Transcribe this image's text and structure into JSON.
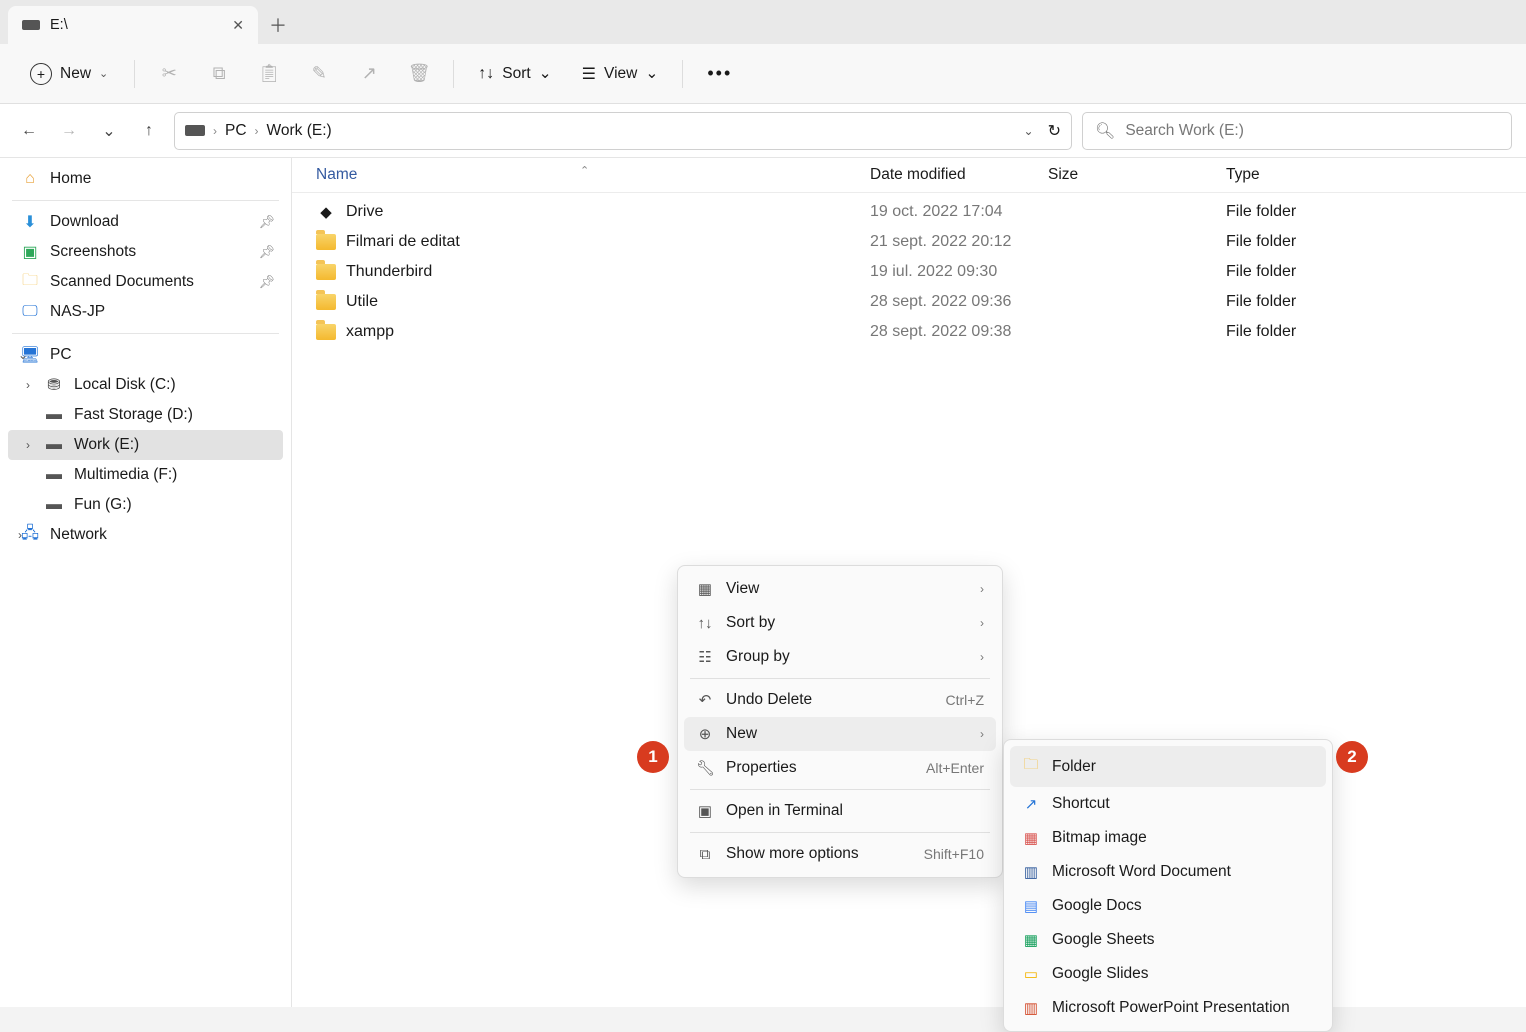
{
  "tab": {
    "title": "E:\\",
    "add_tooltip": "+"
  },
  "toolbar": {
    "new_label": "New",
    "sort_label": "Sort",
    "view_label": "View"
  },
  "breadcrumb": {
    "pc": "PC",
    "location": "Work (E:)"
  },
  "search": {
    "placeholder": "Search Work (E:)"
  },
  "sidebar": {
    "home": "Home",
    "download": "Download",
    "screenshots": "Screenshots",
    "scanned": "Scanned Documents",
    "nas": "NAS-JP",
    "pc": "PC",
    "drives": [
      "Local Disk (C:)",
      "Fast Storage (D:)",
      "Work (E:)",
      "Multimedia (F:)",
      "Fun (G:)"
    ],
    "network": "Network"
  },
  "columns": {
    "name": "Name",
    "date": "Date modified",
    "size": "Size",
    "type": "Type"
  },
  "files": [
    {
      "icon": "drive",
      "name": "Drive",
      "date": "19 oct. 2022 17:04",
      "type": "File folder"
    },
    {
      "icon": "folder",
      "name": "Filmari de editat",
      "date": "21 sept. 2022 20:12",
      "type": "File folder"
    },
    {
      "icon": "folder",
      "name": "Thunderbird",
      "date": "19 iul. 2022 09:30",
      "type": "File folder"
    },
    {
      "icon": "folder",
      "name": "Utile",
      "date": "28 sept. 2022 09:36",
      "type": "File folder"
    },
    {
      "icon": "folder",
      "name": "xampp",
      "date": "28 sept. 2022 09:38",
      "type": "File folder"
    }
  ],
  "ctx1": {
    "view": "View",
    "sortby": "Sort by",
    "groupby": "Group by",
    "undo": "Undo Delete",
    "undo_sc": "Ctrl+Z",
    "new": "New",
    "properties": "Properties",
    "properties_sc": "Alt+Enter",
    "terminal": "Open in Terminal",
    "more": "Show more options",
    "more_sc": "Shift+F10"
  },
  "ctx2": {
    "folder": "Folder",
    "shortcut": "Shortcut",
    "bitmap": "Bitmap image",
    "word": "Microsoft Word Document",
    "gdocs": "Google Docs",
    "gsheets": "Google Sheets",
    "gslides": "Google Slides",
    "ppt": "Microsoft PowerPoint Presentation"
  },
  "callouts": {
    "c1": "1",
    "c2": "2"
  }
}
